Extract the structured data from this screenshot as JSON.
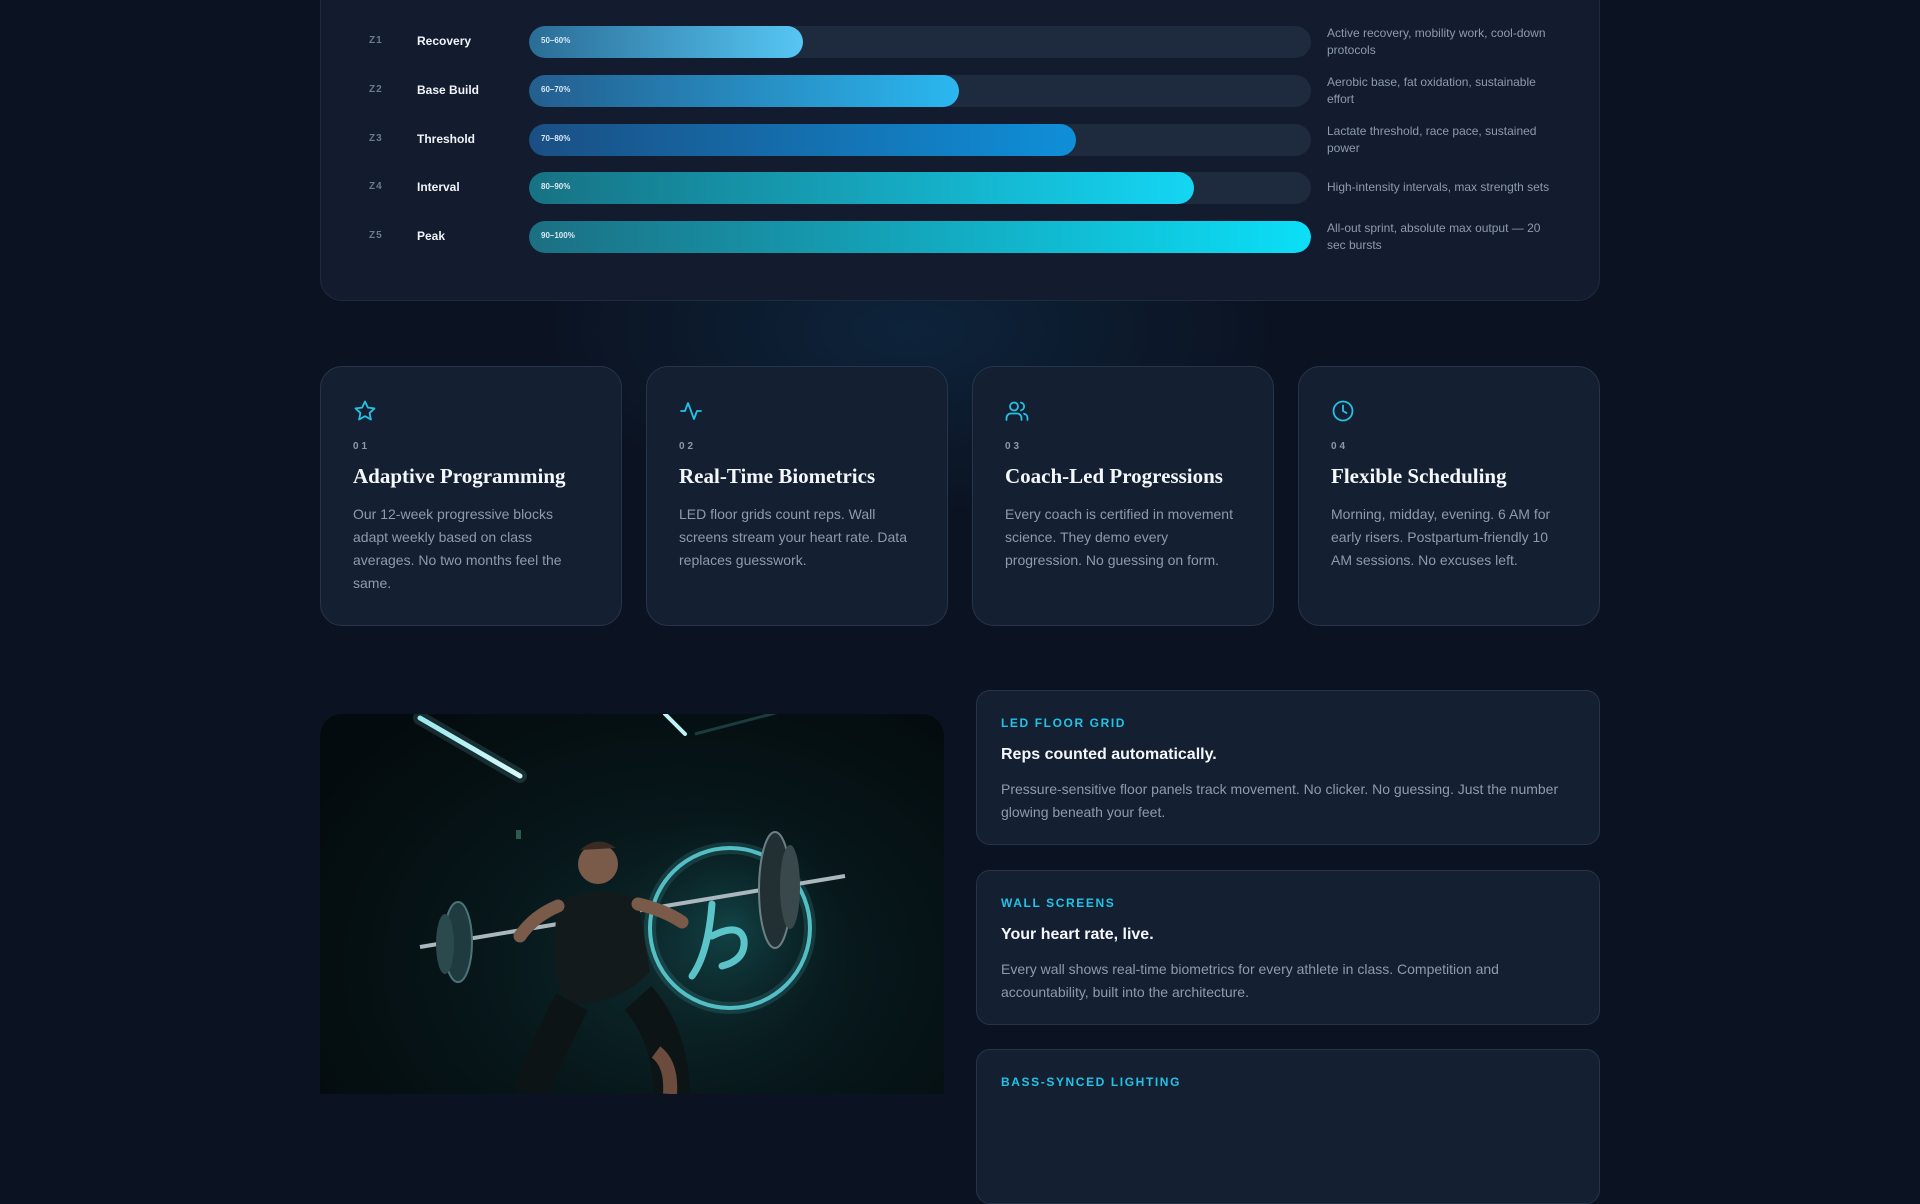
{
  "zones": [
    {
      "code": "Z1",
      "name": "Recovery",
      "range": "50–60%",
      "level": 0.35,
      "description": "Active recovery, mobility work, cool-down protocols",
      "fill": [
        "#2a6d96",
        "#56c6f3"
      ]
    },
    {
      "code": "Z2",
      "name": "Base Build",
      "range": "60–70%",
      "level": 0.55,
      "description": "Aerobic base, fat oxidation, sustainable effort",
      "fill": [
        "#235e8e",
        "#2bb7f0"
      ]
    },
    {
      "code": "Z3",
      "name": "Threshold",
      "range": "70–80%",
      "level": 0.7,
      "description": "Lactate threshold, race pace, sustained power",
      "fill": [
        "#1a4f84",
        "#0f8fd8"
      ]
    },
    {
      "code": "Z4",
      "name": "Interval",
      "range": "80–90%",
      "level": 0.85,
      "description": "High-intensity intervals, max strength sets",
      "fill": [
        "#177283",
        "#14d6f3"
      ]
    },
    {
      "code": "Z5",
      "name": "Peak",
      "range": "90–100%",
      "level": 1.0,
      "description": "All-out sprint, absolute max output — 20 sec bursts",
      "fill": [
        "#1c6f82",
        "#0bdff7"
      ]
    }
  ],
  "features": [
    {
      "icon": "star-icon",
      "number": "01",
      "title": "Adaptive Programming",
      "body": "Our 12-week progressive blocks adapt weekly based on class averages. No two months feel the same."
    },
    {
      "icon": "heart-rate-icon",
      "number": "02",
      "title": "Real-Time Biometrics",
      "body": "LED floor grids count reps. Wall screens stream your heart rate. Data replaces guesswork."
    },
    {
      "icon": "users-icon",
      "number": "03",
      "title": "Coach-Led Progressions",
      "body": "Every coach is certified in movement science. They demo every progression. No guessing on form."
    },
    {
      "icon": "clock-icon",
      "number": "04",
      "title": "Flexible Scheduling",
      "body": "Morning, midday, evening. 6 AM for early risers. Postpartum-friendly 10 AM sessions. No excuses left."
    }
  ],
  "info_cards": [
    {
      "label": "LED FLOOR GRID",
      "title": "Reps counted automatically.",
      "body": "Pressure-sensitive floor panels track movement. No clicker. No guessing. Just the number glowing beneath your feet."
    },
    {
      "label": "WALL SCREENS",
      "title": "Your heart rate, live.",
      "body": "Every wall shows real-time biometrics for every athlete in class. Competition and accountability, built into the architecture."
    },
    {
      "label": "BASS-SYNCED LIGHTING",
      "title": "",
      "body": ""
    }
  ],
  "colors": {
    "accent": "#22c3e6",
    "background": "#0b1322",
    "card": "#141f31"
  }
}
